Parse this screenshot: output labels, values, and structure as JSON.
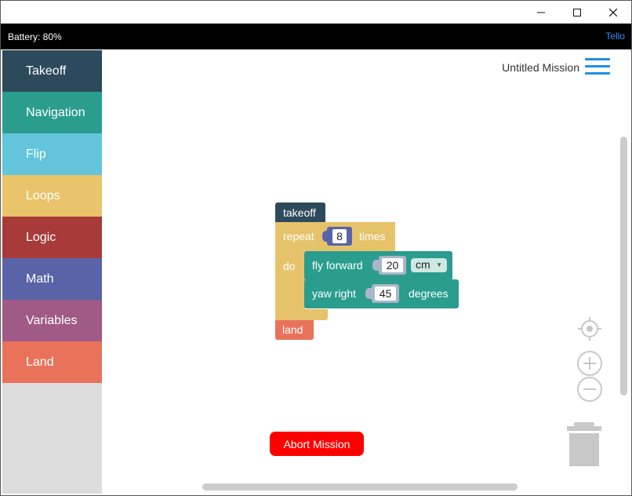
{
  "window": {
    "controls": [
      "minimize-icon",
      "maximize-icon",
      "close-icon"
    ]
  },
  "statusbar": {
    "battery": "Battery: 80%",
    "brand": "Tello"
  },
  "sidebar": {
    "items": [
      {
        "label": "Takeoff",
        "color": "#2d4a5c"
      },
      {
        "label": "Navigation",
        "color": "#2a9d8f"
      },
      {
        "label": "Flip",
        "color": "#63c5dc"
      },
      {
        "label": "Loops",
        "color": "#e9c46a"
      },
      {
        "label": "Logic",
        "color": "#a83a3a"
      },
      {
        "label": "Math",
        "color": "#5a63a8"
      },
      {
        "label": "Variables",
        "color": "#a05a86"
      },
      {
        "label": "Land",
        "color": "#e8735a"
      }
    ]
  },
  "workspace": {
    "mission_title": "Untitled Mission",
    "blocks": {
      "takeoff": "takeoff",
      "repeat_label": "repeat",
      "repeat_count": "8",
      "times_label": "times",
      "do_label": "do",
      "fly_label": "fly forward",
      "fly_distance": "20",
      "fly_unit": "cm",
      "yaw_label": "yaw right",
      "yaw_angle": "45",
      "yaw_unit": "degrees",
      "land": "land"
    },
    "abort_label": "Abort Mission",
    "controls": [
      "recenter-icon",
      "zoom-in-icon",
      "zoom-out-icon",
      "trash-icon"
    ]
  }
}
